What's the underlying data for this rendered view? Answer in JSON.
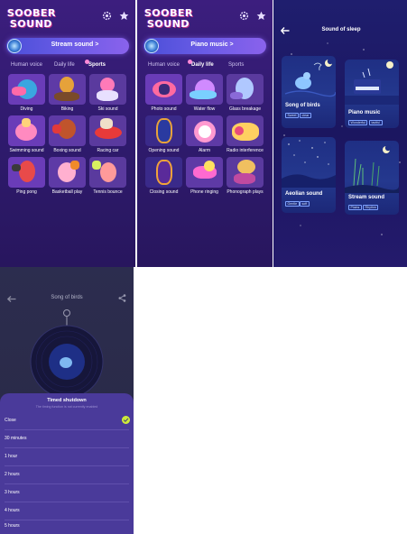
{
  "app": {
    "logo_top": "SOOBER",
    "logo_bottom": "SOUND"
  },
  "colors": {
    "background_purple": "#3c1e7e",
    "banner_blue": "#5a55e0",
    "sleep_navy": "#1f1e6e",
    "sheet_purple": "#4a3a9a",
    "check_green": "#cde83a"
  },
  "panel_sports": {
    "banner_label": "Stream sound",
    "banner_chevron": ">",
    "tabs": [
      {
        "label": "Human voice",
        "active": false
      },
      {
        "label": "Daily life",
        "active": false
      },
      {
        "label": "Sports",
        "active": true
      }
    ],
    "tiles": [
      {
        "label": "Diving",
        "icon": "diver-icon"
      },
      {
        "label": "Biking",
        "icon": "biker-icon"
      },
      {
        "label": "Ski sound",
        "icon": "skier-icon"
      },
      {
        "label": "Swimming sound",
        "icon": "swim-ring-icon"
      },
      {
        "label": "Boxing sound",
        "icon": "boxer-icon"
      },
      {
        "label": "Racing car",
        "icon": "racing-car-icon"
      },
      {
        "label": "Ping pong",
        "icon": "ping-pong-player-icon"
      },
      {
        "label": "Basketball play",
        "icon": "basketball-player-icon"
      },
      {
        "label": "Tennis bounce",
        "icon": "tennis-player-icon"
      }
    ]
  },
  "panel_daily": {
    "banner_label": "Piano music",
    "banner_chevron": ">",
    "tabs": [
      {
        "label": "Human voice",
        "active": false
      },
      {
        "label": "Daily life",
        "active": true
      },
      {
        "label": "Sports",
        "active": false
      }
    ],
    "tiles": [
      {
        "label": "Photo sound",
        "icon": "camera-icon"
      },
      {
        "label": "Water flow",
        "icon": "water-drop-icon"
      },
      {
        "label": "Glass breakage",
        "icon": "broken-glass-icon"
      },
      {
        "label": "Opening sound",
        "icon": "door-icon"
      },
      {
        "label": "Alarm",
        "icon": "alarm-clock-icon"
      },
      {
        "label": "Radio interference",
        "icon": "radio-icon"
      },
      {
        "label": "Closing sound",
        "icon": "closing-door-icon"
      },
      {
        "label": "Phone ringing",
        "icon": "phone-icon"
      },
      {
        "label": "Phonograph plays",
        "icon": "phonograph-icon"
      }
    ]
  },
  "panel_sleep": {
    "title": "Sound of sleep",
    "cards": [
      {
        "name": "Song of birds",
        "tags": [
          "Sweet",
          "clear"
        ],
        "art": "bird-icon"
      },
      {
        "name": "Piano music",
        "tags": [
          "Wonderful",
          "tactful"
        ],
        "art": "piano-icon"
      },
      {
        "name": "Aeolian sound",
        "tags": [
          "Gentle",
          "soft"
        ],
        "art": "wind-icon"
      },
      {
        "name": "Stream sound",
        "tags": [
          "Plains",
          "Rhythm"
        ],
        "art": "stream-icon"
      }
    ]
  },
  "panel_timer": {
    "title": "Song of birds",
    "sheet_title": "Timed shutdown",
    "sheet_subtitle": "The timing function is not currently enabled",
    "options": [
      {
        "label": "Close",
        "selected": true
      },
      {
        "label": "30 minutes",
        "selected": false
      },
      {
        "label": "1 hour",
        "selected": false
      },
      {
        "label": "2 hours",
        "selected": false
      },
      {
        "label": "3 hours",
        "selected": false
      },
      {
        "label": "4 hours",
        "selected": false
      },
      {
        "label": "5 hours",
        "selected": false
      }
    ]
  }
}
